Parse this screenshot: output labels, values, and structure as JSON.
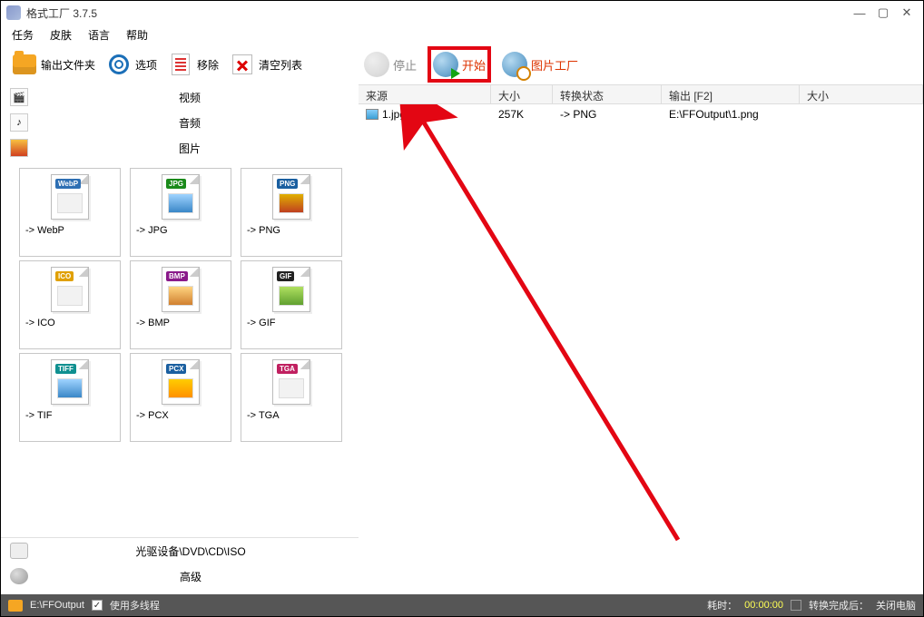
{
  "title": "格式工厂 3.7.5",
  "menu": {
    "task": "任务",
    "skin": "皮肤",
    "lang": "语言",
    "help": "帮助"
  },
  "toolbar_left": {
    "output_folder": "输出文件夹",
    "options": "选项",
    "remove": "移除",
    "clear_list": "清空列表"
  },
  "toolbar_right": {
    "stop": "停止",
    "start": "开始",
    "pic_factory": "图片工厂"
  },
  "categories": {
    "video": "视频",
    "audio": "音频",
    "picture": "图片"
  },
  "formats": [
    {
      "tag": "WebP",
      "tag_color": "#2e6fb3",
      "label": "-> WebP",
      "thumb": "#f2f2f2"
    },
    {
      "tag": "JPG",
      "tag_color": "#1a8a1a",
      "label": "-> JPG",
      "thumb": "linear-gradient(#9fd3ff,#3a87c7)"
    },
    {
      "tag": "PNG",
      "tag_color": "#1a5fa0",
      "label": "-> PNG",
      "thumb": "linear-gradient(#e0b000,#c04020)"
    },
    {
      "tag": "ICO",
      "tag_color": "#e0a000",
      "label": "-> ICO",
      "thumb": "#f2f2f2"
    },
    {
      "tag": "BMP",
      "tag_color": "#8a1a8a",
      "label": "-> BMP",
      "thumb": "linear-gradient(#ffd480,#d08030)"
    },
    {
      "tag": "GIF",
      "tag_color": "#222222",
      "label": "-> GIF",
      "thumb": "linear-gradient(#b0e060,#60a030)"
    },
    {
      "tag": "TIFF",
      "tag_color": "#109090",
      "label": "-> TIF",
      "thumb": "linear-gradient(#9fd3ff,#3a87c7)"
    },
    {
      "tag": "PCX",
      "tag_color": "#1a5fa0",
      "label": "-> PCX",
      "thumb": "linear-gradient(#ffcc00,#ff9000)"
    },
    {
      "tag": "TGA",
      "tag_color": "#c02060",
      "label": "-> TGA",
      "thumb": "#f2f2f2"
    }
  ],
  "bottom_categories": {
    "disc": "光驱设备\\DVD\\CD\\ISO",
    "advanced": "高级"
  },
  "table": {
    "headers": {
      "src": "来源",
      "size": "大小",
      "state": "转换状态",
      "out": "输出 [F2]",
      "size2": "大小"
    },
    "rows": [
      {
        "name": "1.jpg",
        "size": "257K",
        "state": "-> PNG",
        "out": "E:\\FFOutput\\1.png"
      }
    ]
  },
  "status": {
    "out_path": "E:\\FFOutput",
    "multithread": "使用多线程",
    "elapsed_label": "耗时：",
    "elapsed": "00:00:00",
    "after_label": "转换完成后：",
    "after": "关闭电脑"
  }
}
